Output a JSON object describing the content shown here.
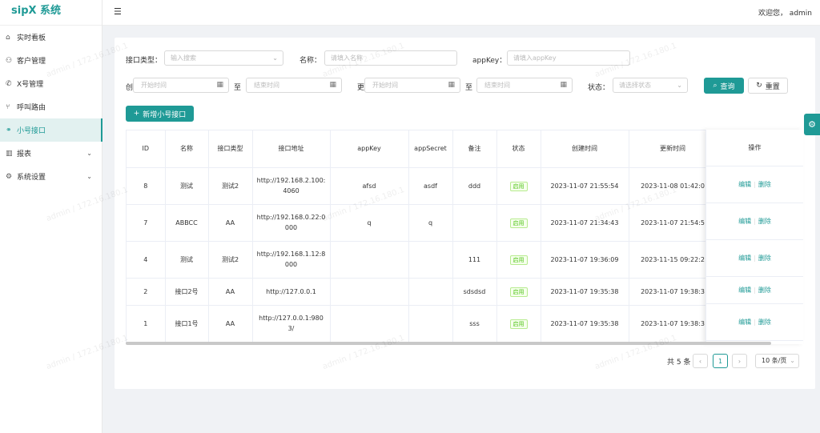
{
  "app": {
    "title": "sipX 系统"
  },
  "sidebar": {
    "items": [
      {
        "label": "实时看板",
        "icon": "home-icon"
      },
      {
        "label": "客户管理",
        "icon": "users-icon"
      },
      {
        "label": "X号管理",
        "icon": "phone-icon"
      },
      {
        "label": "呼叫路由",
        "icon": "route-icon"
      },
      {
        "label": "小号接口",
        "icon": "link-icon",
        "active": true
      },
      {
        "label": "报表",
        "icon": "chart-icon",
        "expandable": true
      },
      {
        "label": "系统设置",
        "icon": "gear-icon",
        "expandable": true
      }
    ]
  },
  "header": {
    "welcome": "欢迎您， admin"
  },
  "filters": {
    "type_label": "接口类型：",
    "type_placeholder": "输入搜索",
    "name_label": "名称：",
    "name_placeholder": "请填入名称",
    "appkey_label": "appKey：",
    "appkey_placeholder": "请填入appKey",
    "create_label": "创",
    "update_label": "更",
    "start_placeholder": "开始时间",
    "end_placeholder": "结束时间",
    "to": "至",
    "status_label": "状态：",
    "status_placeholder": "请选择状态",
    "search_btn": "查询",
    "reset_btn": "重置",
    "add_btn": "新增小号接口"
  },
  "table": {
    "columns": [
      "ID",
      "名称",
      "接口类型",
      "接口地址",
      "appKey",
      "appSecret",
      "备注",
      "状态",
      "创建时间",
      "更新时间",
      "操作"
    ],
    "rows": [
      {
        "id": "8",
        "name": "测试",
        "type": "测试2",
        "url": "http://192.168.2.100:4060",
        "appkey": "afsd",
        "secret": "asdf",
        "remark": "ddd",
        "status": "启用",
        "created": "2023-11-07 21:55:54",
        "updated": "2023-11-08 01:42:0"
      },
      {
        "id": "7",
        "name": "ABBCC",
        "type": "AA",
        "url": "http://192.168.0.22:0000",
        "appkey": "q",
        "secret": "q",
        "remark": "",
        "status": "启用",
        "created": "2023-11-07 21:34:43",
        "updated": "2023-11-07 21:54:5"
      },
      {
        "id": "4",
        "name": "测试",
        "type": "测试2",
        "url": "http://192.168.1.12:8000",
        "appkey": "",
        "secret": "",
        "remark": "111",
        "status": "启用",
        "created": "2023-11-07 19:36:09",
        "updated": "2023-11-15 09:22:2"
      },
      {
        "id": "2",
        "name": "接口2号",
        "type": "AA",
        "url": "http://127.0.0.1",
        "appkey": "",
        "secret": "",
        "remark": "sdsdsd",
        "status": "启用",
        "created": "2023-11-07 19:35:38",
        "updated": "2023-11-07 19:38:3"
      },
      {
        "id": "1",
        "name": "接口1号",
        "type": "AA",
        "url": "http://127.0.0.1:9803/",
        "appkey": "",
        "secret": "",
        "remark": "sss",
        "status": "启用",
        "created": "2023-11-07 19:35:38",
        "updated": "2023-11-07 19:38:3"
      }
    ],
    "edit": "编辑",
    "delete": "删除"
  },
  "pagination": {
    "total": "共 5 条",
    "current": "1",
    "page_size": "10 条/页"
  },
  "watermark": "admin / 172.16.180.1",
  "colors": {
    "primary": "#1f9a96",
    "tag_green": "#52c41a"
  }
}
